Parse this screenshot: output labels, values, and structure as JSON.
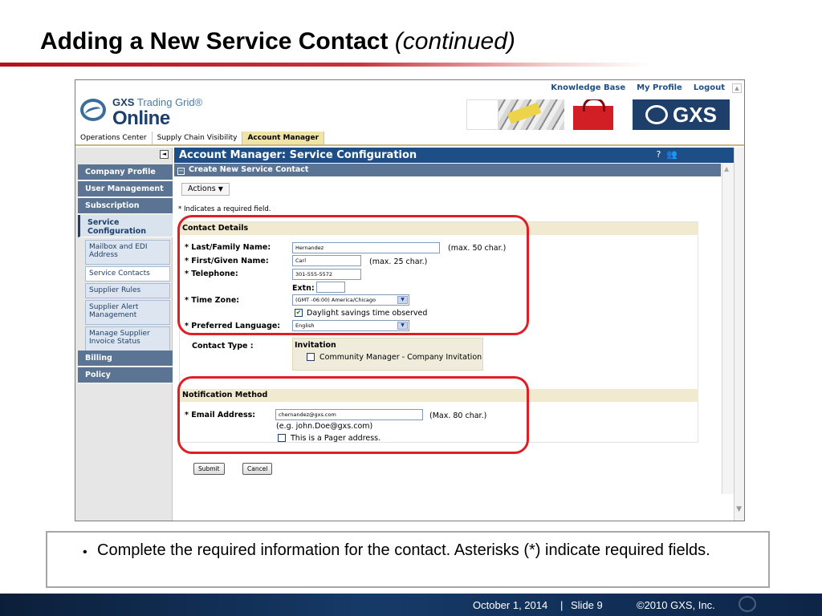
{
  "slide": {
    "title_main": "Adding a New Service Contact",
    "title_cont": "(continued)",
    "bullet": "Complete the required information for the contact.  Asterisks (*) indicate required fields.",
    "footer_date": "October 1, 2014",
    "footer_sep": "|",
    "footer_slide": "Slide 9",
    "footer_copy": "©2010 GXS, Inc."
  },
  "app": {
    "top_links": [
      "Knowledge Base",
      "My Profile",
      "Logout"
    ],
    "logo_line1_bold": "GXS",
    "logo_line1_rest": "Trading Grid®",
    "logo_line2": "Online",
    "brand_box_text": "GXS",
    "tabs": [
      "Operations Center",
      "Supply Chain Visibility",
      "Account Manager"
    ],
    "active_tab": "Account Manager"
  },
  "nav": {
    "collapse_icon": "◄",
    "items": [
      "Company Profile",
      "User Management",
      "Subscription",
      "Service Configuration",
      "Billing",
      "Policy"
    ],
    "sub_items": [
      "Mailbox and EDI Address",
      "Service Contacts",
      "Supplier Rules",
      "Supplier Alert Management",
      "Manage Supplier Invoice Status"
    ]
  },
  "main": {
    "header": "Account Manager: Service Configuration",
    "help_icon": "?",
    "people_icon": "👥",
    "section_title": "Create New Service Contact",
    "actions_label": "Actions",
    "required_note": "* Indicates a required field."
  },
  "contact": {
    "heading": "Contact Details",
    "last_label": "* Last/Family Name:",
    "last_value": "Hernandez",
    "last_hint": "(max. 50 char.)",
    "first_label": "* First/Given Name:",
    "first_value": "Carl",
    "first_hint": "(max. 25 char.)",
    "tel_label": "* Telephone:",
    "tel_value": "301-555-5572",
    "extn_label": "Extn:",
    "tz_label": "* Time Zone:",
    "tz_value": "(GMT -06:00) America/Chicago",
    "dst_label": "Daylight savings time observed",
    "dst_checked": true,
    "lang_label": "* Preferred Language:",
    "lang_value": "English",
    "type_label": "Contact Type   :",
    "type_heading": "Invitation",
    "type_option": "Community Manager - Company Invitation"
  },
  "notification": {
    "heading": "Notification Method",
    "email_label": "* Email Address:",
    "email_value": "chernandez@gxs.com",
    "email_hint": "(Max. 80 char.)",
    "email_example": "(e.g. john.Doe@gxs.com)",
    "pager_label": "This is a Pager address."
  },
  "buttons": {
    "submit": "Submit",
    "cancel": "Cancel"
  },
  "colors": {
    "accent_red": "#e01e26",
    "header_blue": "#1d4f86",
    "nav_slate": "#5b7494"
  }
}
